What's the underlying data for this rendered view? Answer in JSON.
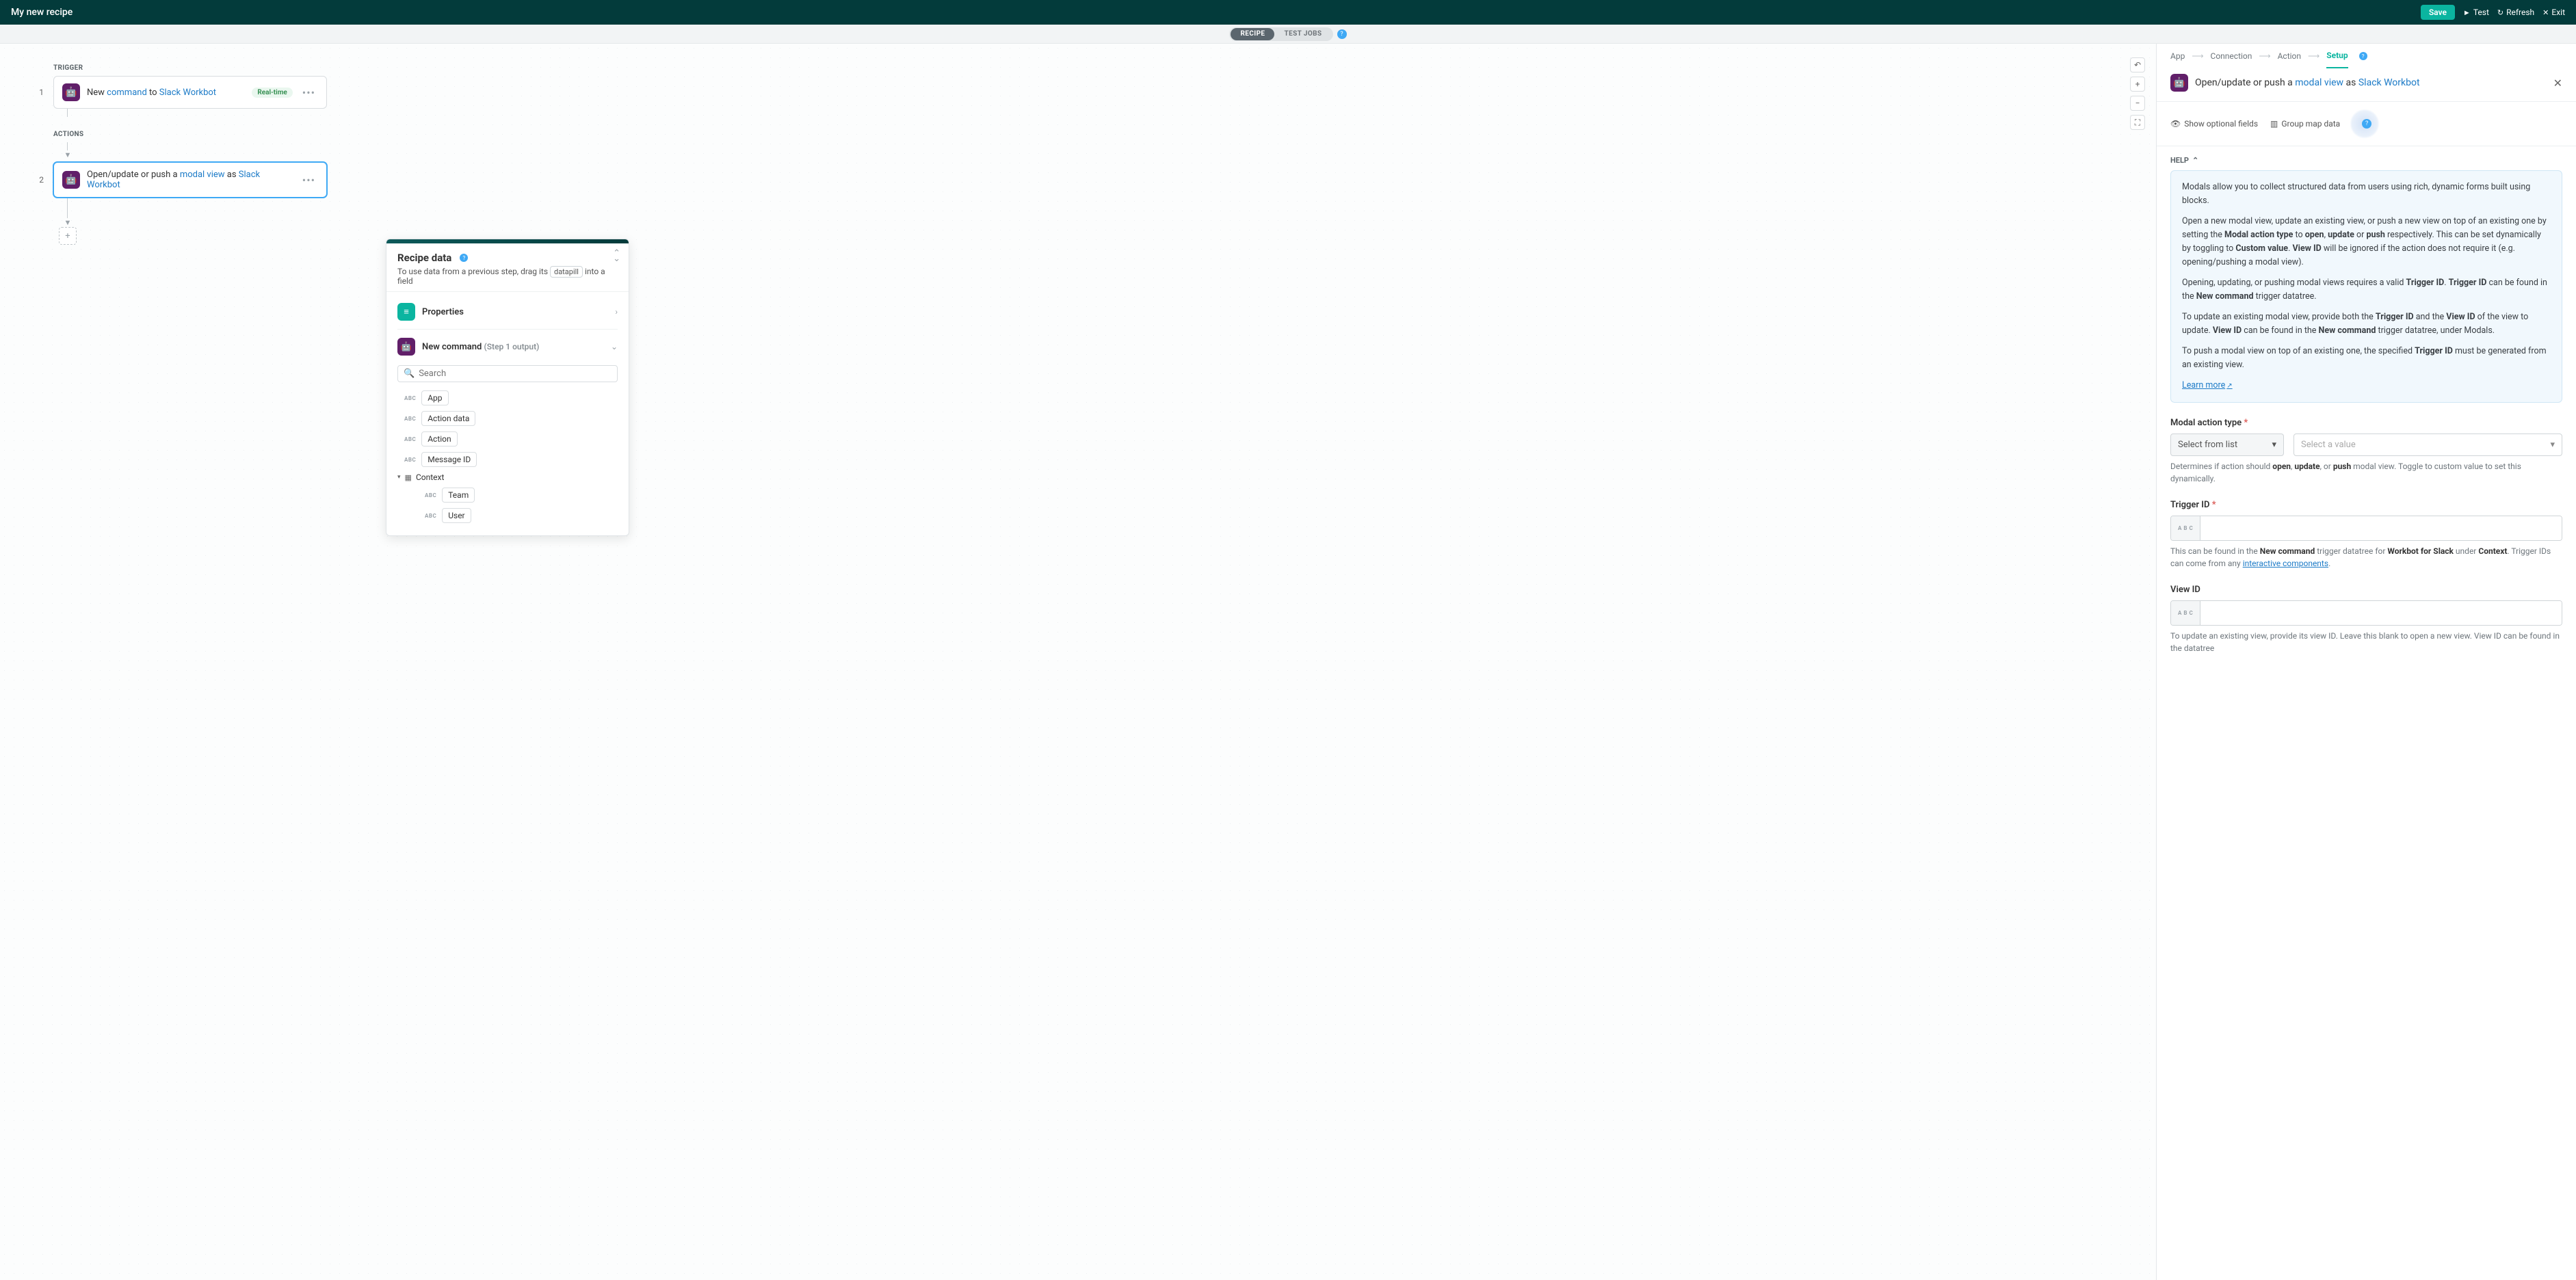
{
  "topbar": {
    "title": "My new recipe",
    "save": "Save",
    "test": "Test",
    "refresh": "Refresh",
    "exit": "Exit"
  },
  "tabs": {
    "recipe": "RECIPE",
    "test_jobs": "TEST JOBS"
  },
  "flow": {
    "trigger_label": "TRIGGER",
    "actions_label": "ACTIONS",
    "step1": {
      "num": "1",
      "prefix": "New ",
      "cmd": "command",
      "to": " to ",
      "app": "Slack Workbot",
      "badge": "Real-time"
    },
    "step2": {
      "num": "2",
      "prefix": "Open/update or push a ",
      "mv": "modal view",
      "as": " as ",
      "app": "Slack Workbot"
    }
  },
  "data_panel": {
    "title": "Recipe data",
    "sub_pre": "To use data from a previous step, drag its ",
    "pill": "datapill",
    "sub_post": " into a field",
    "properties": "Properties",
    "new_cmd": "New command",
    "step_ref": "(Step 1 output)",
    "search_ph": "Search",
    "items": {
      "app": "App",
      "action_data": "Action data",
      "action": "Action",
      "msg_id": "Message ID",
      "context": "Context",
      "team": "Team",
      "user": "User"
    }
  },
  "crumbs": {
    "app": "App",
    "conn": "Connection",
    "action": "Action",
    "setup": "Setup"
  },
  "rp_header": {
    "prefix": "Open/update or push a ",
    "mv": "modal view",
    "as": " as ",
    "app": "Slack Workbot"
  },
  "rp_tools": {
    "show_opt": "Show optional fields",
    "group": "Group map data"
  },
  "help_label": "HELP",
  "help": {
    "p1": "Modals allow you to collect structured data from users using rich, dynamic forms built using blocks.",
    "p2a": "Open a new modal view, update an existing view, or push a new view on top of an existing one by setting the ",
    "mat": "Modal action type",
    "to": " to ",
    "open": "open",
    "comma": ", ",
    "update": "update",
    "or": " or ",
    "push": "push",
    "p2b": " respectively. This can be set dynamically by toggling to ",
    "cv": "Custom value",
    "dot": ". ",
    "vid": "View ID",
    "p2c": " will be ignored if the action does not require it (e.g. opening/pushing a modal view).",
    "p3a": "Opening, updating, or pushing modal views requires a valid ",
    "tid": "Trigger ID",
    "p3b": " can be found in the ",
    "ncmd": "New command",
    "p3c": " trigger datatree.",
    "p4a": "To update an existing modal view, provide both the ",
    "and": " and the ",
    "p4b": " of the view to update. ",
    "p4c": " can be found in the ",
    "p4d": " trigger datatree, under Modals.",
    "p5a": "To push a modal view on top of an existing one, the specified ",
    "p5b": " must be generated from an existing view.",
    "learn": "Learn more"
  },
  "form": {
    "mat_label": "Modal action type",
    "select": "Select from list",
    "select_val": "Select a value",
    "mat_desc_pre": "Determines if action should ",
    "mat_desc_post": " modal view. Toggle to custom value to set this dynamically.",
    "comma_or": ", or ",
    "tid_label": "Trigger ID",
    "tid_desc_a": "This can be found in the ",
    "tid_desc_b": " trigger datatree for ",
    "wfs": "Workbot for Slack",
    "under": " under ",
    "ctx": "Context",
    "tid_desc_c": ". Trigger IDs can come from any ",
    "int_comp": "interactive components",
    "vid_label": "View ID",
    "vid_desc": "To update an existing view, provide its view ID. Leave this blank to open a new view. View ID can be found in the datatree"
  }
}
